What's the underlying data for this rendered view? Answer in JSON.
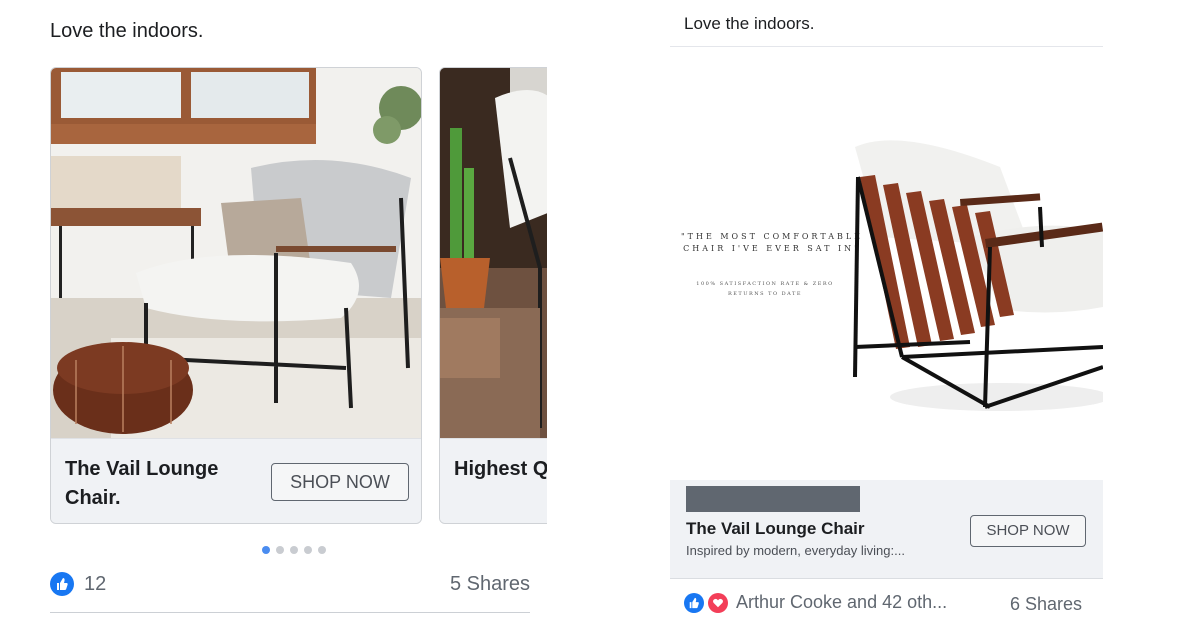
{
  "left_post": {
    "caption": "Love the indoors.",
    "cards": [
      {
        "title": "The Vail Lounge Chair.",
        "cta": "SHOP NOW"
      },
      {
        "title": "Highest Quality Material.",
        "cta": ""
      }
    ],
    "carousel": {
      "count": 5,
      "active_index": 0
    },
    "reactions": {
      "count": "12",
      "shares": "5 Shares"
    }
  },
  "right_post": {
    "caption": "Love the indoors.",
    "hero": {
      "quote": "\"THE MOST COMFORTABLE CHAIR I'VE EVER SAT IN\"",
      "subquote": "100% SATISFACTION RATE & ZERO RETURNS TO DATE"
    },
    "link": {
      "title": "The Vail Lounge Chair",
      "description": "Inspired by modern, everyday living:...",
      "cta": "SHOP NOW"
    },
    "reactions": {
      "names": "Arthur Cooke and 42 oth...",
      "shares": "6 Shares"
    }
  },
  "colors": {
    "like": "#1877f2",
    "love": "#f33e58",
    "dot_active": "#4a8cf0"
  },
  "icons": [
    "like-icon",
    "love-icon"
  ]
}
